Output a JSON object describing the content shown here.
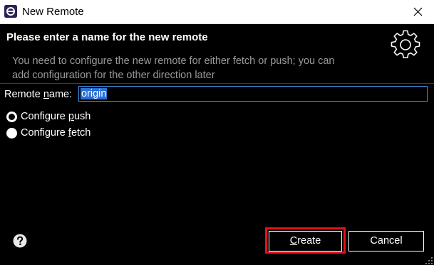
{
  "window": {
    "title": "New Remote",
    "app_icon": "eclipse-icon",
    "close_icon": "close-icon"
  },
  "header": {
    "heading": "Please enter a name for the new remote",
    "description_line1": "You need to configure the new remote for either fetch or push; you can",
    "description_line2": "add configuration for the other direction later",
    "banner_icon": "gear-icon"
  },
  "form": {
    "remote_name_label_prefix": "Remote ",
    "remote_name_label_mnemonic": "n",
    "remote_name_label_suffix": "ame:",
    "remote_name_value": "origin",
    "options": [
      {
        "label_prefix": "Configure ",
        "label_mnemonic": "p",
        "label_suffix": "ush",
        "selected": true
      },
      {
        "label_prefix": "Configure ",
        "label_mnemonic": "f",
        "label_suffix": "etch",
        "selected": false
      }
    ]
  },
  "footer": {
    "help_icon": "help-icon",
    "create_mnemonic": "C",
    "create_rest": "reate",
    "cancel_label": "Cancel",
    "highlight_color": "#e3131c"
  },
  "colors": {
    "background": "#000000",
    "title_bar": "#ffffff",
    "selection": "#2a6fd6",
    "input_border": "#3c8fd8",
    "description_text": "#9a9a9a"
  }
}
